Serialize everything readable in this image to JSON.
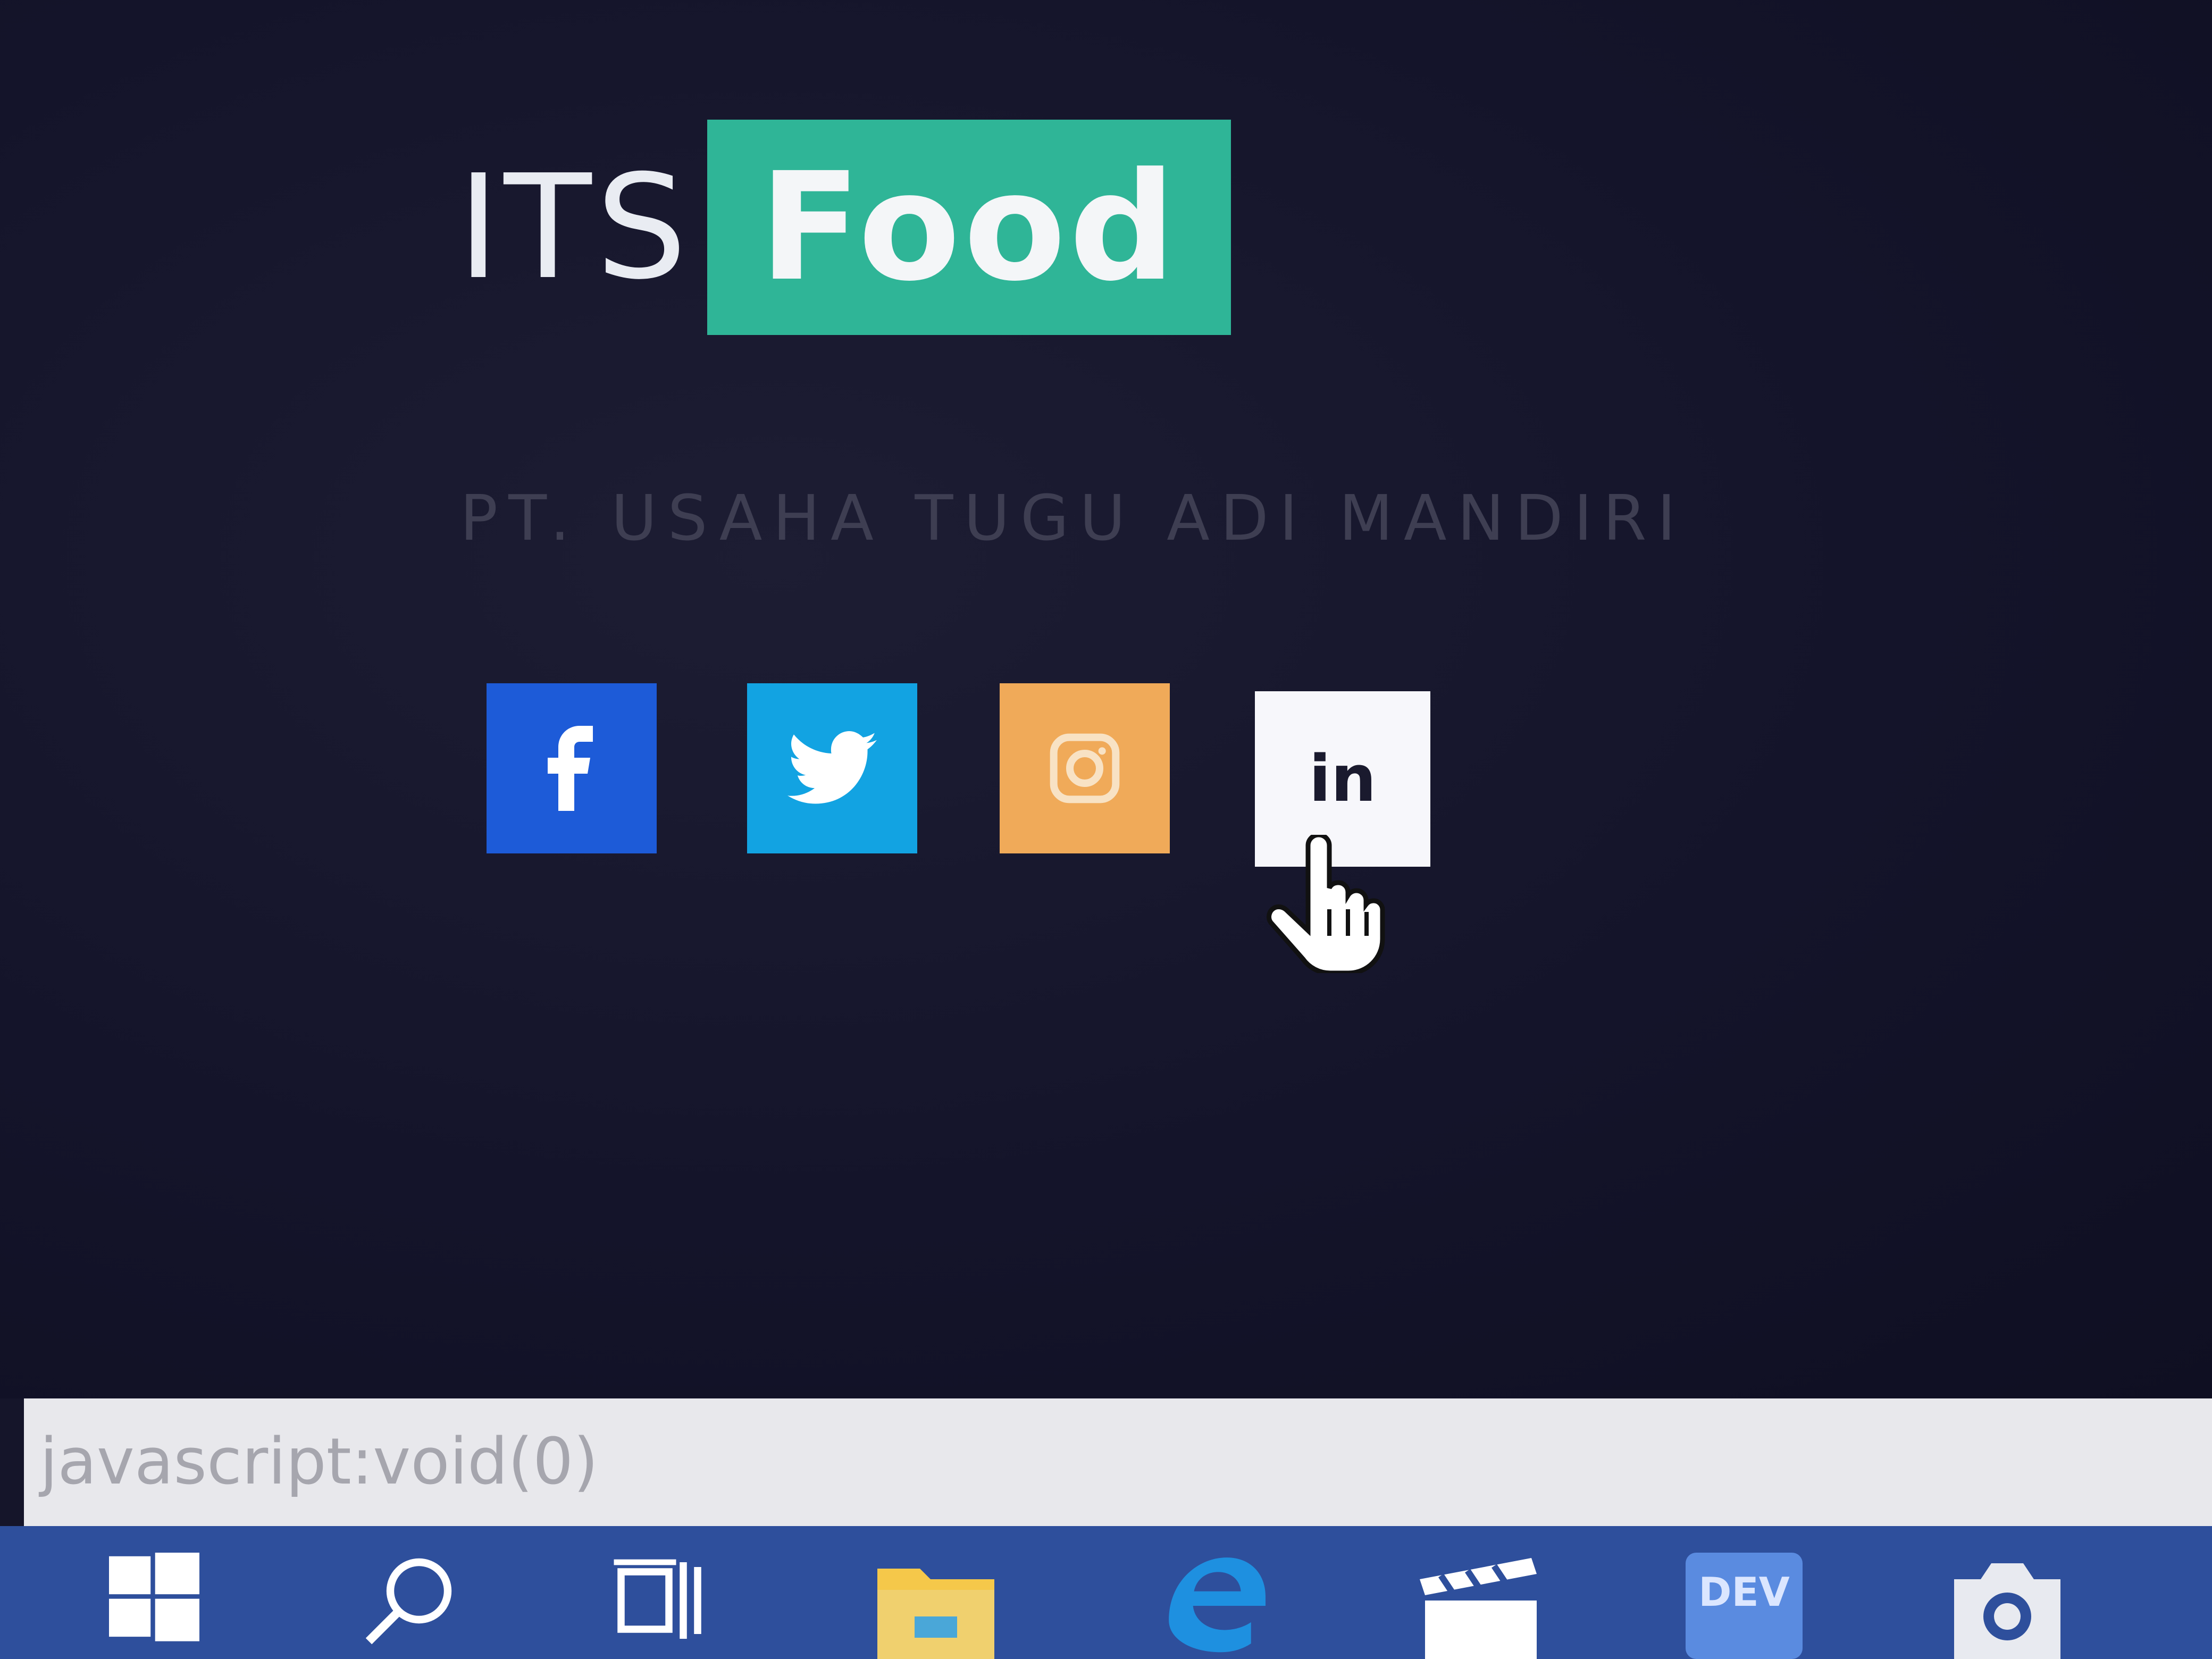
{
  "brand": {
    "its_text": "ITS",
    "food_text": "Food",
    "accent_color": "#2fb597"
  },
  "tagline": "PT. USAHA TUGU ADI MANDIRI",
  "social": [
    {
      "name": "facebook",
      "icon": "facebook-icon",
      "glyph": "f",
      "color": "#1d5bd8"
    },
    {
      "name": "twitter",
      "icon": "twitter-bird-icon",
      "color": "#12a3e2"
    },
    {
      "name": "instagram",
      "icon": "instagram-icon",
      "color": "#f0aa59"
    },
    {
      "name": "linkedin",
      "icon": "linkedin-icon",
      "glyph": "in",
      "color": "#f7f7fb"
    }
  ],
  "statusbar": {
    "url": "javascript:void(0)"
  },
  "taskbar": {
    "color": "#2e4f9c",
    "items": [
      "windows-start-icon",
      "search-icon",
      "task-view-icon",
      "file-explorer-icon",
      "edge-icon",
      "movies-tv-icon",
      "dev-app-icon",
      "camera-icon"
    ]
  }
}
